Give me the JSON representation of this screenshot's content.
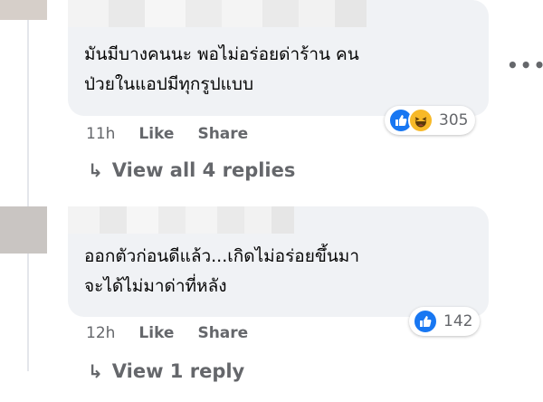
{
  "comments": [
    {
      "text_line1": "มันมีบางคนนะ พอไม่อร่อยด่าร้าน คน",
      "text_line2": "ป่วยในแอปมีทุกรูปแบบ",
      "time": "11h",
      "like_label": "Like",
      "share_label": "Share",
      "reaction_count": "305",
      "reactions": [
        "like-icon",
        "haha-icon"
      ],
      "replies_label": "View all 4 replies"
    },
    {
      "text_line1": "ออกตัวก่อนดีแล้ว...เกิดไม่อร่อยขึ้นมา",
      "text_line2": "จะได้ไม่มาด่าที่หลัง",
      "time": "12h",
      "like_label": "Like",
      "share_label": "Share",
      "reaction_count": "142",
      "reactions": [
        "like-icon"
      ],
      "replies_label": "View 1 reply"
    }
  ],
  "more_label": "•••",
  "reply_arrow": "↳",
  "colors": {
    "bubble": "#f0f2f5",
    "secondary_text": "#65676b",
    "like_blue": "#1877f2",
    "haha_yellow": "#f7b928"
  }
}
